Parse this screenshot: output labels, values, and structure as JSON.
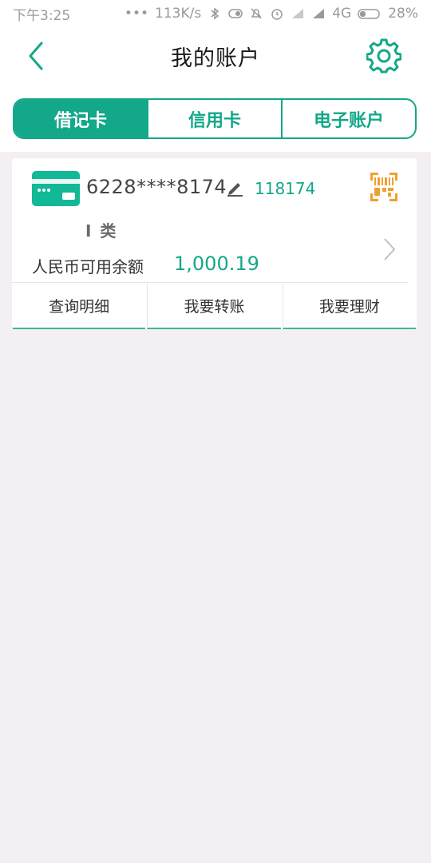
{
  "status_bar": {
    "time": "下午3:25",
    "dots": "•••",
    "network_speed": "113K/s",
    "network_type": "4G",
    "battery": "28%"
  },
  "header": {
    "title": "我的账户"
  },
  "tabs": [
    {
      "label": "借记卡",
      "active": true
    },
    {
      "label": "信用卡",
      "active": false
    },
    {
      "label": "电子账户",
      "active": false
    }
  ],
  "account_card": {
    "card_number": "6228****8174",
    "alias": "118174",
    "card_class": "I 类",
    "balance_label": "人民币可用余额",
    "balance_value": "1,000.19",
    "actions": [
      {
        "label": "查询明细"
      },
      {
        "label": "我要转账"
      },
      {
        "label": "我要理财"
      }
    ]
  },
  "colors": {
    "accent": "#13a88a",
    "qr_icon": "#f0a030",
    "background": "#f4eff3"
  },
  "icons": {
    "back": "chevron-left-icon",
    "settings": "gear-icon",
    "card": "bank-card-icon",
    "edit": "pencil-icon",
    "qr": "qr-code-icon",
    "chevron": "chevron-right-icon"
  }
}
